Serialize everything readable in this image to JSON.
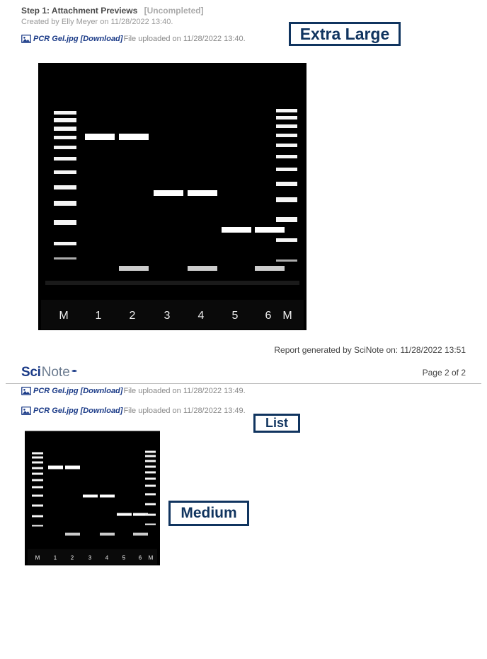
{
  "step": {
    "title": "Step 1: Attachment Previews",
    "status": "[Uncompleted]"
  },
  "created_by": "Created by Elly Meyer on 11/28/2022 13:40.",
  "attachments": [
    {
      "name": "PCR Gel.jpg",
      "download": "[Download]",
      "meta": "File uploaded on 11/28/2022 13:40."
    },
    {
      "name": "PCR Gel.jpg",
      "download": "[Download]",
      "meta": "File uploaded on 11/28/2022 13:49."
    },
    {
      "name": "PCR Gel.jpg",
      "download": "[Download]",
      "meta": "File uploaded on 11/28/2022 13:49."
    }
  ],
  "callouts": {
    "xl": "Extra Large",
    "list": "List",
    "medium": "Medium"
  },
  "report_gen": "Report generated by SciNote on: 11/28/2022 13:51",
  "logo": {
    "part1": "Sci",
    "part2": "Note"
  },
  "page_num": "Page 2 of 2",
  "gel": {
    "lanes": [
      "M",
      "1",
      "2",
      "3",
      "4",
      "5",
      "6",
      "M"
    ]
  }
}
